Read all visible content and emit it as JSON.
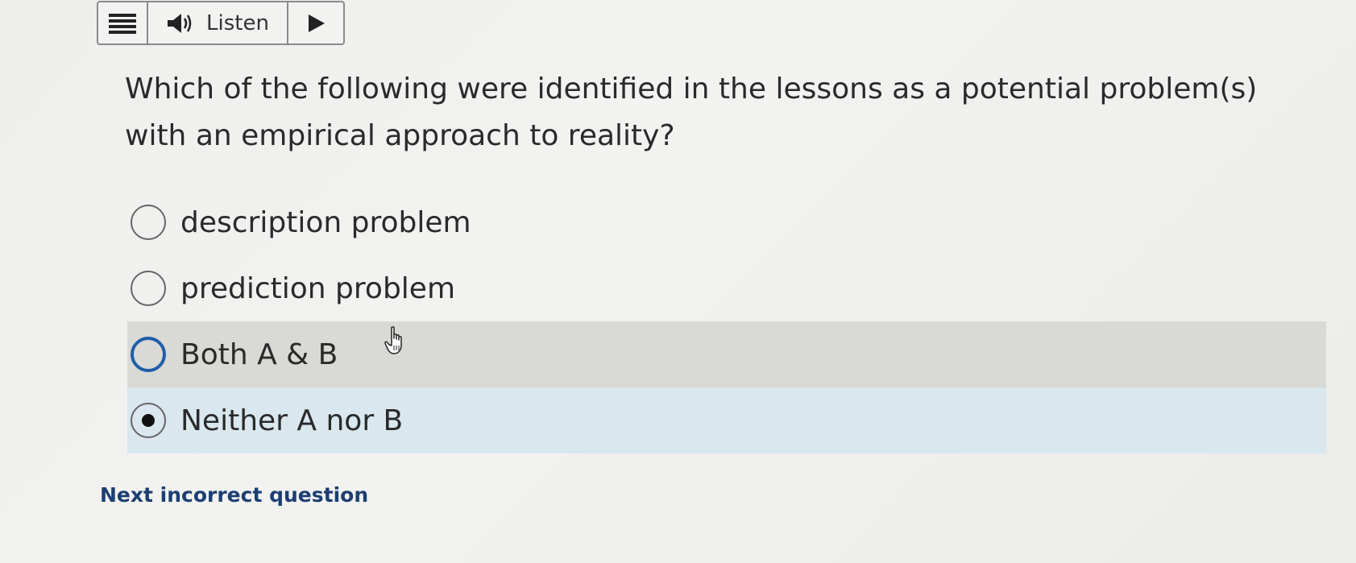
{
  "toolbar": {
    "menu_icon": "hamburger-icon",
    "speaker_icon": "speaker-icon",
    "listen_label": "Listen",
    "play_icon": "play-icon"
  },
  "question": {
    "text": "Which of the following were identified in the lessons as a potential problem(s) with an empirical approach to reality?"
  },
  "options": [
    {
      "label": "description problem",
      "state": "unselected"
    },
    {
      "label": "prediction problem",
      "state": "unselected"
    },
    {
      "label": "Both A & B",
      "state": "hovered"
    },
    {
      "label": "Neither A nor B",
      "state": "selected"
    }
  ],
  "footer": {
    "next_link": "Next incorrect question"
  },
  "colors": {
    "link": "#1c3f72",
    "focus_ring": "#1f5ea8",
    "hover_bg": "#d9d9d6",
    "selected_bg": "#d9e7ee"
  }
}
